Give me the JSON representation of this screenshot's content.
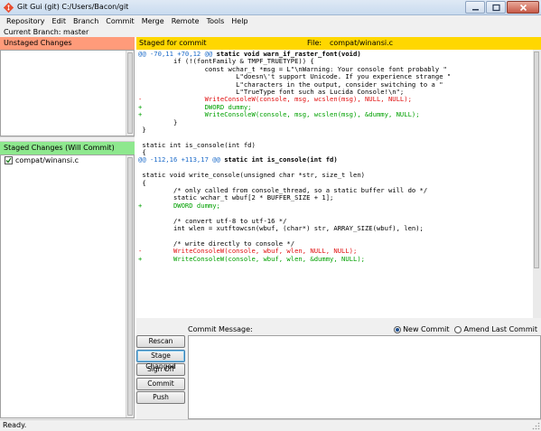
{
  "window": {
    "title": "Git Gui (git) C:/Users/Bacon/git"
  },
  "menu": [
    "Repository",
    "Edit",
    "Branch",
    "Commit",
    "Merge",
    "Remote",
    "Tools",
    "Help"
  ],
  "branch_label": "Current Branch: master",
  "unstaged": {
    "header": "Unstaged Changes",
    "files": []
  },
  "staged": {
    "header": "Staged Changes (Will Commit)",
    "files": [
      "compat/winansi.c"
    ]
  },
  "diff": {
    "header_label": "Staged for commit",
    "file_label": "File:",
    "file_path": "compat/winansi.c",
    "lines": [
      {
        "type": "hunk",
        "marker": "@@ -70,11 +70,12 @@",
        "func": " static void warn_if_raster_font(void)"
      },
      {
        "type": "ctx",
        "text": "         if (!(fontFamily & TMPF_TRUETYPE)) {"
      },
      {
        "type": "ctx",
        "text": "                 const wchar_t *msg = L\"\\nWarning: Your console font probably \""
      },
      {
        "type": "ctx",
        "text": "                         L\"doesn\\'t support Unicode. If you experience strange \""
      },
      {
        "type": "ctx",
        "text": "                         L\"characters in the output, consider switching to a \""
      },
      {
        "type": "ctx",
        "text": "                         L\"TrueType font such as Lucida Console!\\n\";"
      },
      {
        "type": "del",
        "text": "-                WriteConsoleW(console, msg, wcslen(msg), NULL, NULL);"
      },
      {
        "type": "add",
        "text": "+                DWORD dummy;"
      },
      {
        "type": "add",
        "text": "+                WriteConsoleW(console, msg, wcslen(msg), &dummy, NULL);"
      },
      {
        "type": "ctx",
        "text": "         }"
      },
      {
        "type": "ctx",
        "text": " }"
      },
      {
        "type": "ctx",
        "text": ""
      },
      {
        "type": "ctx",
        "text": " static int is_console(int fd)"
      },
      {
        "type": "ctx",
        "text": " {"
      },
      {
        "type": "hunk",
        "marker": "@@ -112,16 +113,17 @@",
        "func": " static int is_console(int fd)"
      },
      {
        "type": "ctx",
        "text": ""
      },
      {
        "type": "ctx",
        "text": " static void write_console(unsigned char *str, size_t len)"
      },
      {
        "type": "ctx",
        "text": " {"
      },
      {
        "type": "ctx",
        "text": "         /* only called from console_thread, so a static buffer will do */"
      },
      {
        "type": "ctx",
        "text": "         static wchar_t wbuf[2 * BUFFER_SIZE + 1];"
      },
      {
        "type": "add",
        "text": "+        DWORD dummy;"
      },
      {
        "type": "ctx",
        "text": ""
      },
      {
        "type": "ctx",
        "text": "         /* convert utf-8 to utf-16 */"
      },
      {
        "type": "ctx",
        "text": "         int wlen = xutftowcsn(wbuf, (char*) str, ARRAY_SIZE(wbuf), len);"
      },
      {
        "type": "ctx",
        "text": ""
      },
      {
        "type": "ctx",
        "text": "         /* write directly to console */"
      },
      {
        "type": "del",
        "text": "-        WriteConsoleW(console, wbuf, wlen, NULL, NULL);"
      },
      {
        "type": "add",
        "text": "+        WriteConsoleW(console, wbuf, wlen, &dummy, NULL);"
      }
    ]
  },
  "commit": {
    "message_label": "Commit Message:",
    "message": "",
    "new_commit_label": "New Commit",
    "amend_label": "Amend Last Commit",
    "selected_mode": "New Commit",
    "buttons": {
      "rescan": "Rescan",
      "stage_changed": "Stage Changed",
      "sign_off": "Sign Off",
      "commit": "Commit",
      "push": "Push"
    }
  },
  "status": "Ready.",
  "colors": {
    "unstaged_header": "#ff9b7a",
    "staged_header": "#8ee88e",
    "diff_header": "#ffd700",
    "added": "#00a000",
    "removed": "#e01010",
    "hunk": "#1b6ac9"
  },
  "icons": {
    "app": "git-gui-app-icon",
    "minimize": "minimize-icon",
    "maximize": "maximize-icon",
    "close": "close-icon",
    "checkbox": "check-icon",
    "grip": "resize-grip-icon"
  }
}
